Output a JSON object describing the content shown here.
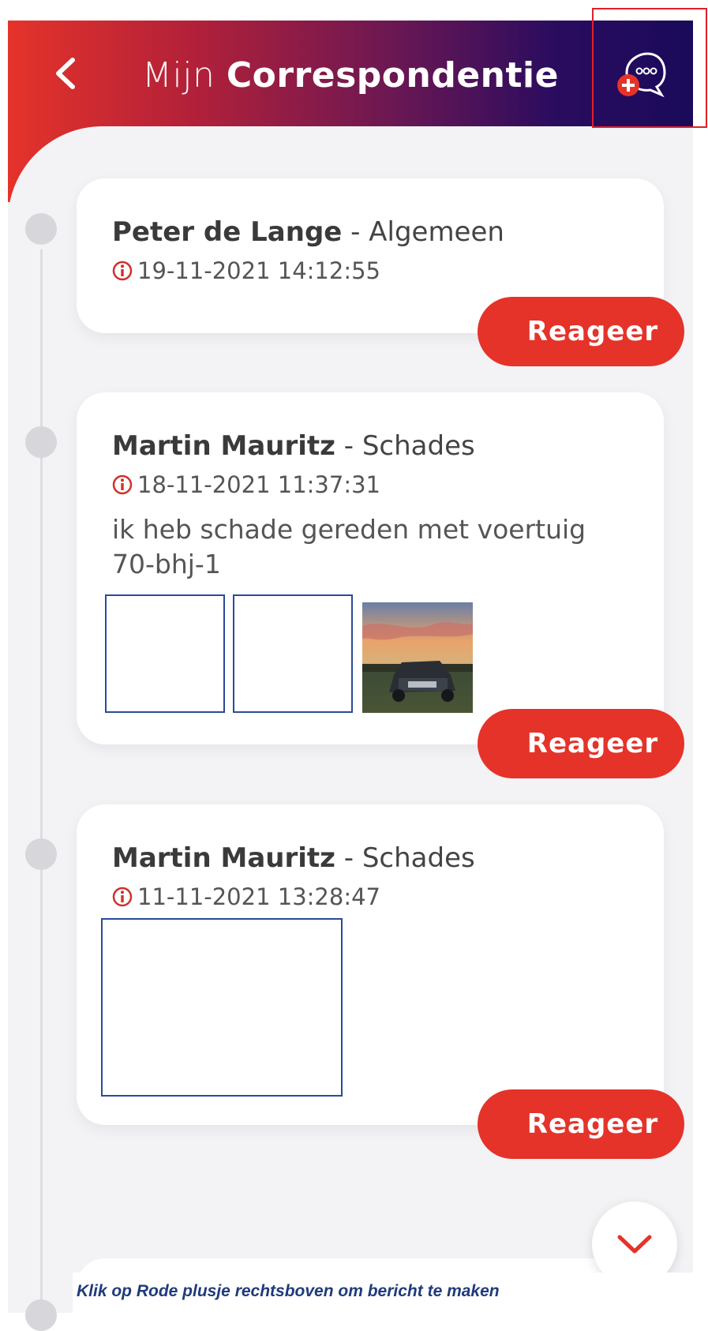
{
  "header": {
    "title_light": "Mijn",
    "title_bold": "Correspondentie",
    "back_icon": "chevron-left-icon",
    "new_message_icon": "new-message-icon"
  },
  "messages": [
    {
      "sender": "Peter de Lange",
      "category": "- Algemeen",
      "date": "19-11-2021 14:12:55",
      "body": "",
      "react_label": "Reageer"
    },
    {
      "sender": "Martin Mauritz",
      "category": "- Schades",
      "date": "18-11-2021 11:37:31",
      "body": "ik heb schade gereden met voertuig 70-bhj-1",
      "react_label": "Reageer"
    },
    {
      "sender": "Martin Mauritz",
      "category": "- Schades",
      "date": "11-11-2021 13:28:47",
      "body": "",
      "react_label": "Reageer"
    }
  ],
  "scroll_down_icon": "chevron-down-icon",
  "caption": "Klik op Rode plusje rechtsboven om bericht te maken",
  "colors": {
    "accent": "#e5332a",
    "header_end": "#1a0a5a",
    "caption": "#1f3b7a"
  }
}
